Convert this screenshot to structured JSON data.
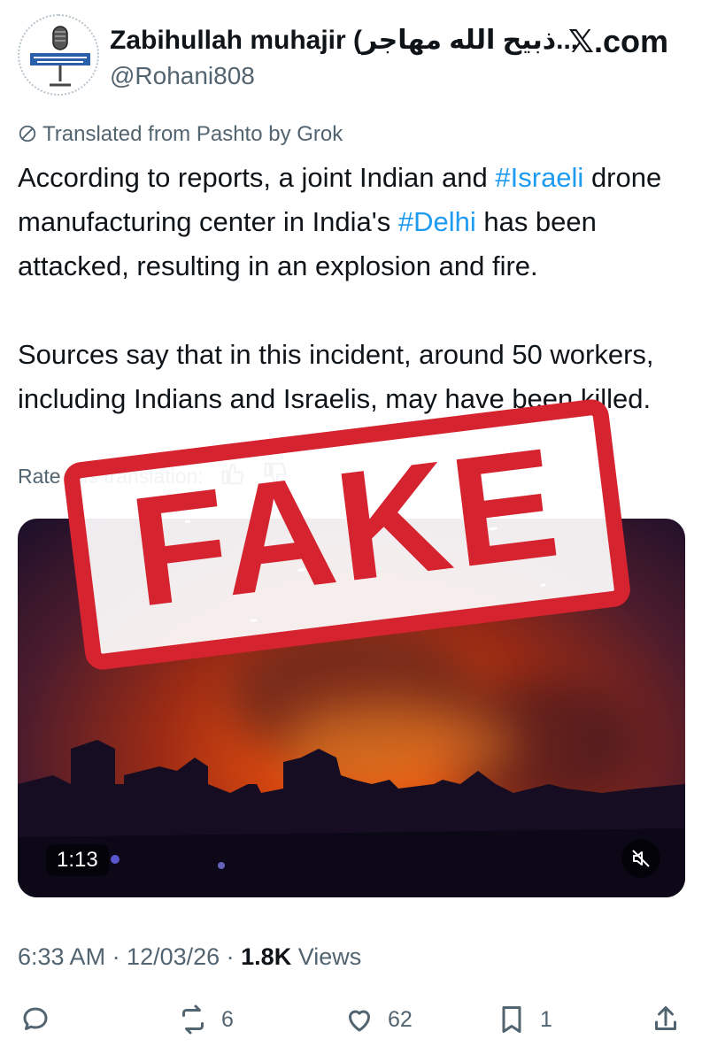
{
  "header": {
    "display_name": "Zabihullah muhajir (ذبیح الله مهاجر...",
    "handle": "@Rohani808",
    "site": "𝕏.com",
    "avatar_icon": "microphone-logo-icon"
  },
  "translation_note": "Translated from Pashto by Grok",
  "tweet": {
    "p1_a": "According to reports, a joint Indian and ",
    "p1_tag1": "#Israeli",
    "p1_b": " drone manufacturing center in India's ",
    "p1_tag2": "#Delhi",
    "p1_c": " has been attacked, resulting in an explosion and fire.",
    "p2": "Sources say that in this incident, around 50 workers, including Indians and Israelis, may have been killed."
  },
  "rate_translation": "Rate this translation:",
  "media": {
    "duration": "1:13",
    "mute_icon": "speaker-muted-icon"
  },
  "stamp": {
    "label": "FAKE"
  },
  "meta": {
    "time_date": "6:33 AM · 12/03/26 · ",
    "views_count": "1.8K",
    "views_label": " Views"
  },
  "actions": {
    "reply_count": "",
    "repost_count": "6",
    "like_count": "62",
    "bookmark_count": "1"
  },
  "colors": {
    "link": "#1d9bf0",
    "secondary_text": "#536471",
    "stamp_red": "#d5232f"
  }
}
